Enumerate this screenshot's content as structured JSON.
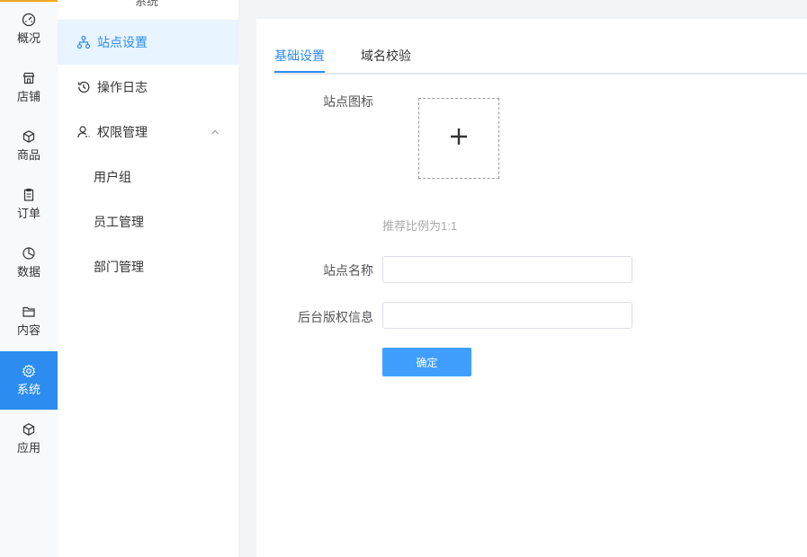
{
  "rail": {
    "items": [
      {
        "label": "概况",
        "icon": "dashboard-icon"
      },
      {
        "label": "店铺",
        "icon": "store-icon"
      },
      {
        "label": "商品",
        "icon": "box-icon"
      },
      {
        "label": "订单",
        "icon": "clipboard-icon"
      },
      {
        "label": "数据",
        "icon": "pie-chart-icon"
      },
      {
        "label": "内容",
        "icon": "folder-icon"
      },
      {
        "label": "系统",
        "icon": "gear-icon",
        "active": true
      },
      {
        "label": "应用",
        "icon": "cube-icon"
      }
    ],
    "accent": "#2d8cf0"
  },
  "submenu": {
    "title": "系统",
    "items": [
      {
        "label": "站点设置",
        "icon": "sitemap-icon"
      },
      {
        "label": "操作日志",
        "icon": "history-icon"
      },
      {
        "label": "权限管理",
        "icon": "user-icon"
      }
    ],
    "children": [
      {
        "label": "用户组"
      },
      {
        "label": "员工管理"
      },
      {
        "label": "部门管理"
      }
    ]
  },
  "main": {
    "tabs": [
      {
        "label": "基础设置"
      },
      {
        "label": "域名校验"
      }
    ],
    "form": {
      "icon_label": "站点图标",
      "icon_hint": "推荐比例为1:1",
      "name_label": "站点名称",
      "name_value": "",
      "copyright_label": "后台版权信息",
      "copyright_value": "",
      "submit_label": "确定"
    }
  }
}
